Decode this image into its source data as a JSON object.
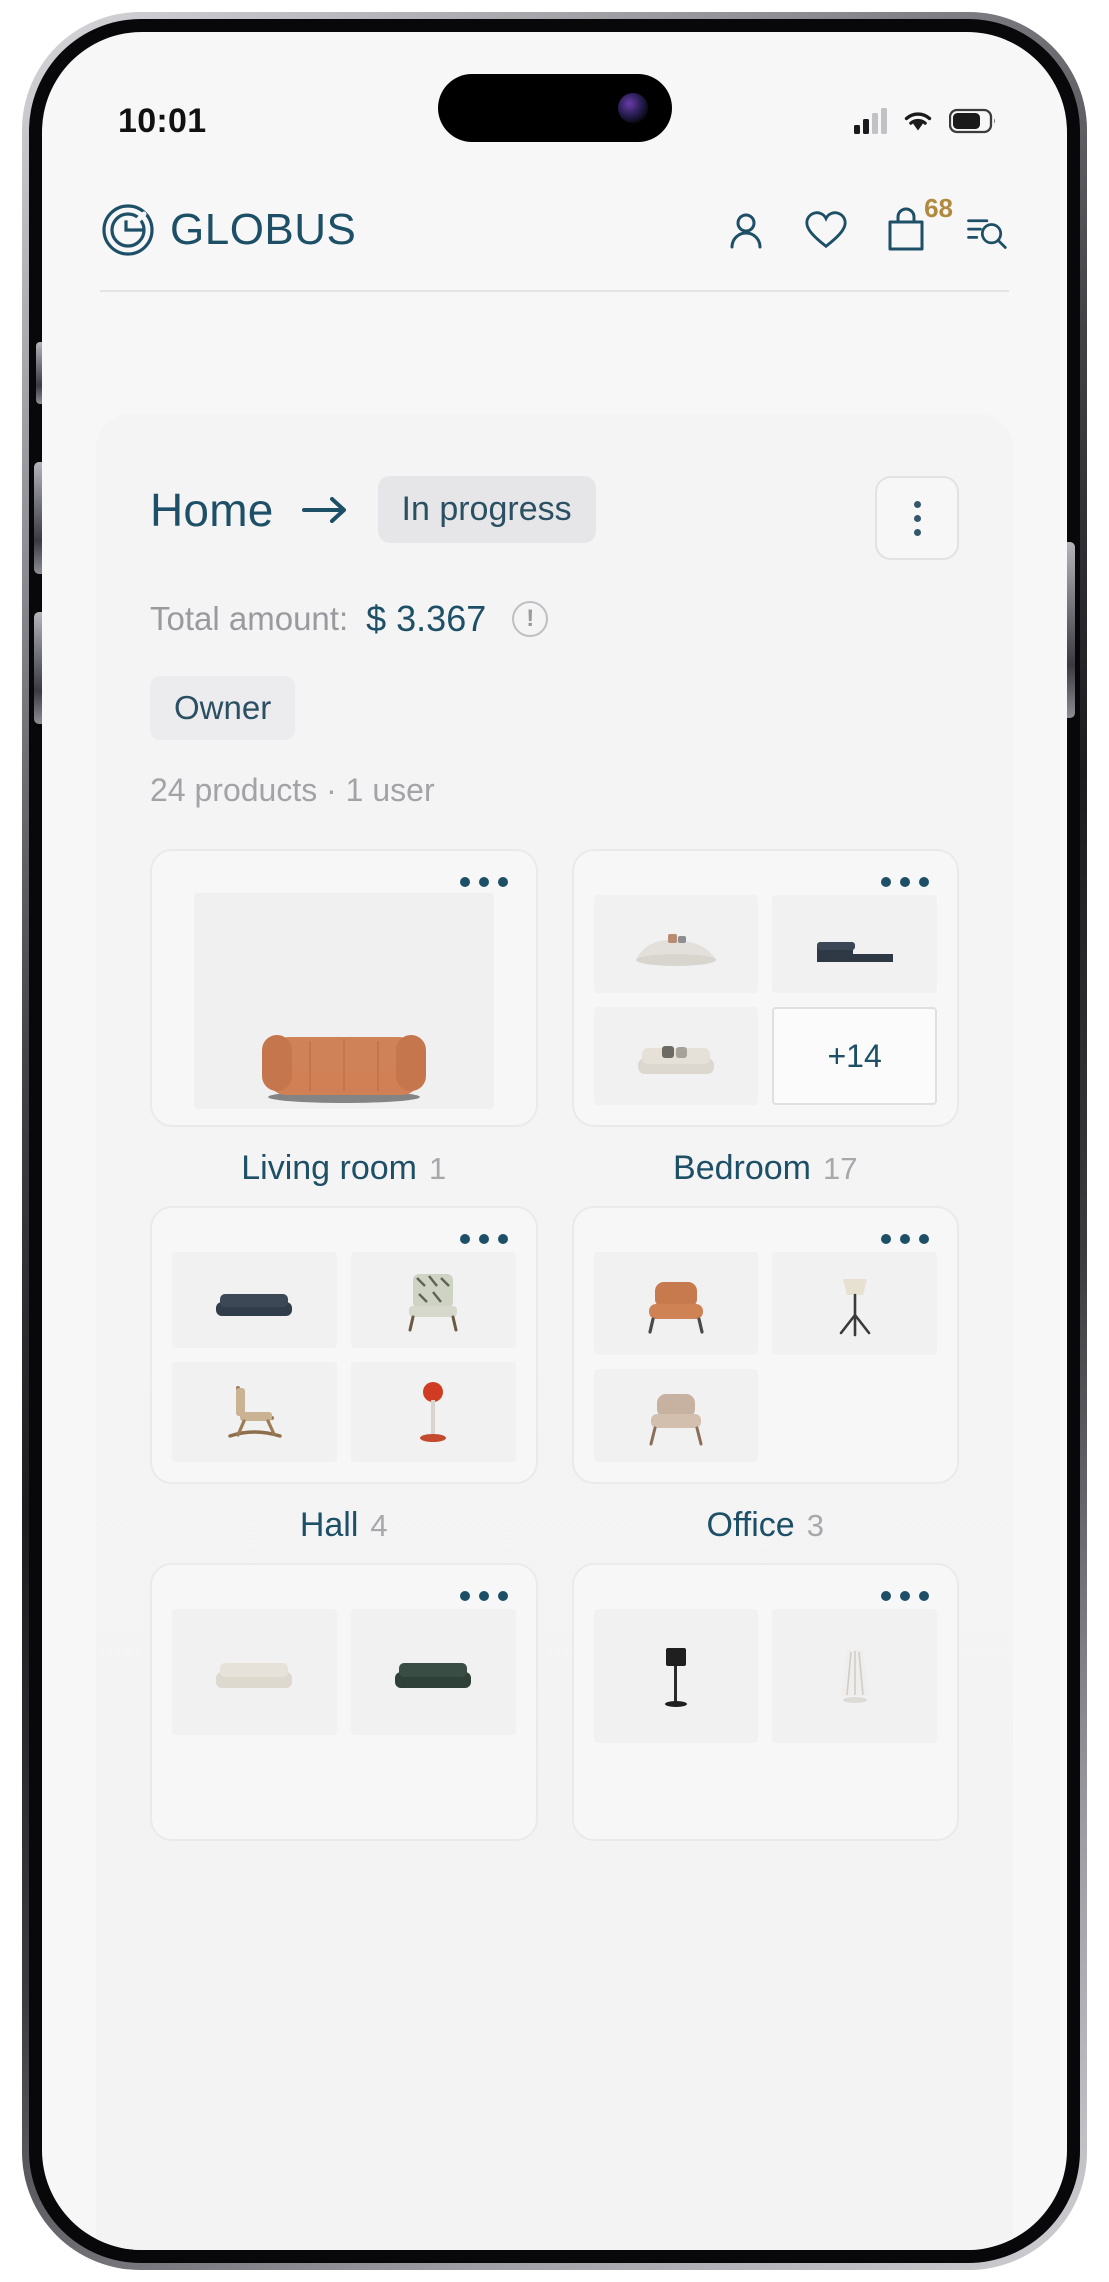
{
  "status_bar": {
    "time": "10:01",
    "signal_icon": "cellular-signal-icon",
    "wifi_icon": "wifi-icon",
    "battery_icon": "battery-icon"
  },
  "header": {
    "logo_icon": "globus-logo-icon",
    "brand": "GLOBUS",
    "actions": [
      {
        "name": "account-icon",
        "label": "Account"
      },
      {
        "name": "favorites-heart-icon",
        "label": "Favorites"
      },
      {
        "name": "shopping-bag-icon",
        "label": "Cart",
        "badge": "68"
      },
      {
        "name": "filter-search-icon",
        "label": "Search"
      }
    ],
    "badge_color": "#b08a3e",
    "brand_color": "#1d4f66"
  },
  "project": {
    "title": "Home",
    "arrow_icon": "arrow-right-icon",
    "status": "In progress",
    "more_icon": "kebab-menu-icon",
    "amount_label": "Total amount:",
    "amount_value": "$ 3.367",
    "info_icon": "info-circle-icon",
    "info_glyph": "!",
    "role": "Owner",
    "meta": "24 products · 1 user"
  },
  "rooms": [
    {
      "name": "Living room",
      "count": "1",
      "layout": "single",
      "menu_icon": "kebab-menu-icon",
      "items": [
        {
          "alt": "orange-leather-sofa"
        }
      ]
    },
    {
      "name": "Bedroom",
      "count": "17",
      "layout": "grid",
      "menu_icon": "kebab-menu-icon",
      "items": [
        {
          "alt": "cream-curved-sofa"
        },
        {
          "alt": "dark-navy-sectional-sofa"
        },
        {
          "alt": "beige-sofa-with-pillows"
        }
      ],
      "more_label": "+14"
    },
    {
      "name": "Hall",
      "count": "4",
      "layout": "grid",
      "menu_icon": "kebab-menu-icon",
      "items": [
        {
          "alt": "navy-blue-sofa"
        },
        {
          "alt": "patterned-armchair"
        },
        {
          "alt": "wooden-rocking-chair"
        },
        {
          "alt": "red-floor-lamp"
        }
      ]
    },
    {
      "name": "Office",
      "count": "3",
      "layout": "grid",
      "menu_icon": "kebab-menu-icon",
      "items": [
        {
          "alt": "orange-leather-armchair"
        },
        {
          "alt": "tripod-floor-lamp"
        },
        {
          "alt": "beige-lounge-chair"
        }
      ]
    },
    {
      "name": "",
      "count": "",
      "layout": "grid",
      "menu_icon": "kebab-menu-icon",
      "items": [
        {
          "alt": "cream-sofa"
        },
        {
          "alt": "dark-green-sofa"
        }
      ]
    },
    {
      "name": "",
      "count": "",
      "layout": "grid",
      "menu_icon": "kebab-menu-icon",
      "items": [
        {
          "alt": "black-floor-lamp"
        },
        {
          "alt": "white-pleated-lamp"
        }
      ]
    }
  ]
}
